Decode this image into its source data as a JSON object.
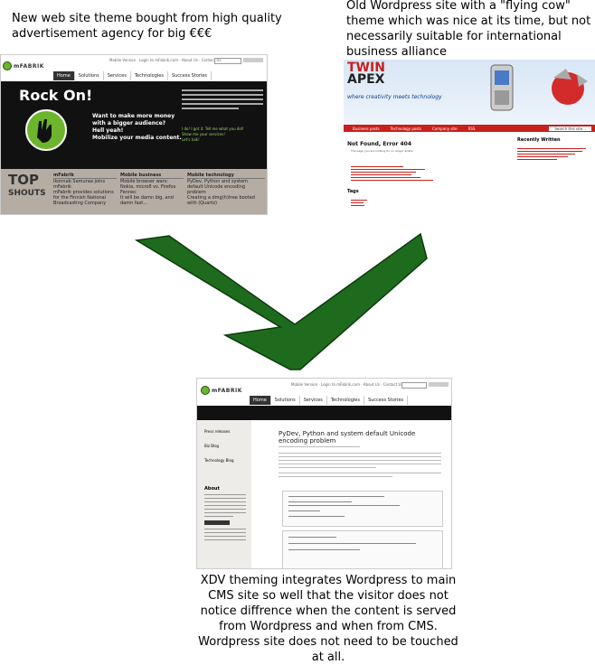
{
  "captions": {
    "new_theme": "New web site theme bought from high quality advertisement agency for big €€€",
    "old_wordpress": "Old Wordpress site with a \"flying cow\" theme which was nice at its time, but not necessarily suitable for international business alliance",
    "result": "XDV theming integrates Wordpress to main CMS site so well that the visitor does not notice diffrence when the content is served from Wordpress and when from CMS. Wordpress site does not need to be touched at all."
  },
  "new_site": {
    "logo": "mFABRIK",
    "nav": [
      "Home",
      "Solutions",
      "Services",
      "Technologies",
      "Success Stories"
    ],
    "hero_title": "Rock On!",
    "hero_lines": [
      "Want to make more money",
      "with a bigger audience?",
      "Hell yeah!",
      "Mobilize your media content."
    ],
    "side_links": [
      "I do! I got it. Tell me what you did!",
      "Show me your services!",
      "Let's talk!"
    ],
    "top_label": "TOP",
    "shouts_label": "SHOUTS",
    "col_titles": [
      "mFabrik",
      "Mobile business",
      "Mobile technology"
    ],
    "col_items": [
      [
        "Ikonnab Samuraa joins mFabrik",
        "mFabrik provides solutions for the Finnish National Broadcasting Company"
      ],
      [
        "Mobile browser wars: Nokia, micro8 vs. Firefox Fennec",
        "It will be damn big, and damn fast..."
      ],
      [
        "PyDev, Python and system default Unicode encoding problem",
        "Creating a dmg(h)tree booted with (Quartz)"
      ]
    ]
  },
  "old_site": {
    "logo_top": "TWIN",
    "logo_bottom": "APEX",
    "tagline": "where creativity meets technology",
    "nav": [
      "Business posts",
      "Technology posts",
      "Company site",
      "RSS"
    ],
    "search": "Search this site...",
    "heading": "Not Found, Error 404",
    "sub": "The page you are looking for no longer exists.",
    "recent_title": "Recently Written",
    "tags_title": "Tags"
  },
  "result_site": {
    "logo": "mFABRIK",
    "nav": [
      "Home",
      "Solutions",
      "Services",
      "Technologies",
      "Success Stories"
    ],
    "side_links": [
      "Press releases",
      "Biz Blog",
      "Technology Blog"
    ],
    "about_title": "About",
    "post_title": "PyDev, Python and system default Unicode encoding problem"
  },
  "colors": {
    "arrow_fill": "#1e6b1e",
    "arrow_stroke": "#0d3a0d",
    "mfabrik_green": "#6cb52d",
    "twinapex_red": "#c8201c"
  }
}
